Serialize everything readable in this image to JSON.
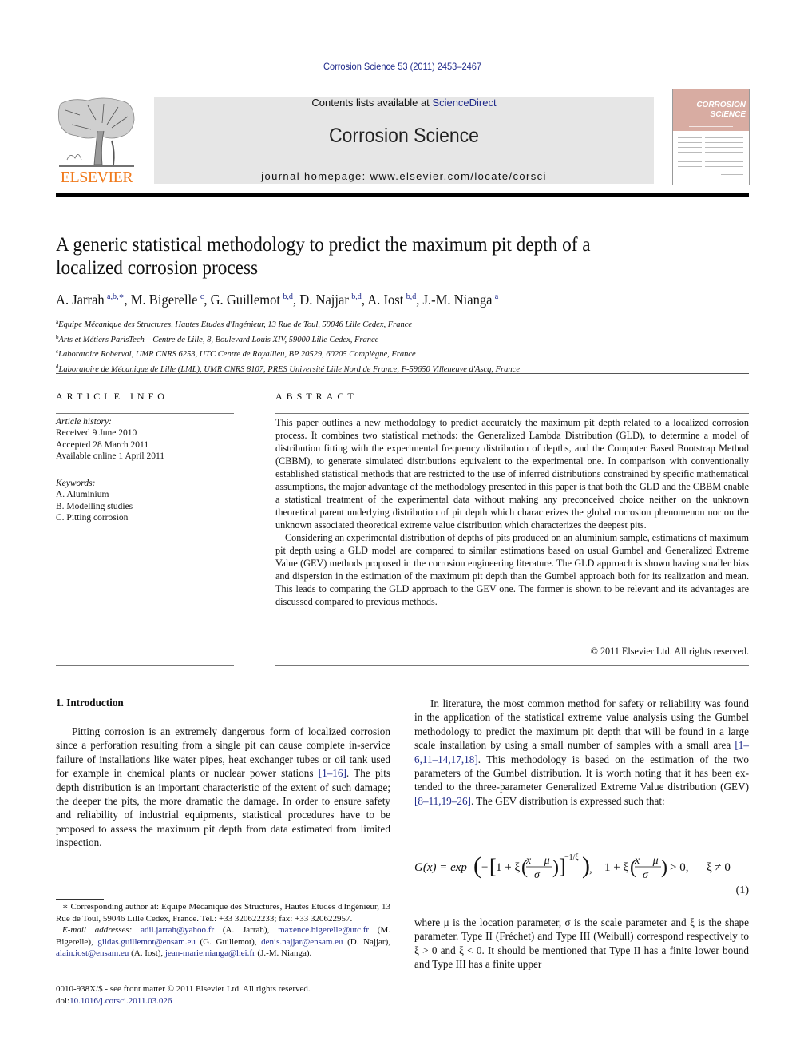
{
  "header": {
    "citation": "Corrosion Science 53 (2011) 2453–2467",
    "contents_prefix": "Contents lists available at ",
    "contents_link": "ScienceDirect",
    "journal_title": "Corrosion Science",
    "homepage": "journal homepage: www.elsevier.com/locate/corsci",
    "publisher_logo_text": "ELSEVIER",
    "cover": {
      "line1": "CORROSION",
      "line2": "SCIENCE",
      "color": "#d8aca2"
    },
    "colors": {
      "link": "#1f2a8a",
      "elsevier_orange": "#f07a1c",
      "banner_bg": "#e6e6e6"
    }
  },
  "article": {
    "title": "A generic statistical methodology to predict the maximum pit depth of a localized corrosion process",
    "authors": [
      {
        "name": "A. Jarrah",
        "aff": "a,b,∗"
      },
      {
        "name": "M. Bigerelle",
        "aff": "c"
      },
      {
        "name": "G. Guillemot",
        "aff": "b,d"
      },
      {
        "name": "D. Najjar",
        "aff": "b,d"
      },
      {
        "name": "A. Iost",
        "aff": "b,d"
      },
      {
        "name": "J.-M. Nianga",
        "aff": "a"
      }
    ],
    "affiliations": [
      {
        "key": "a",
        "text": "Equipe Mécanique des Structures, Hautes Etudes d'Ingénieur, 13 Rue de Toul, 59046 Lille Cedex, France"
      },
      {
        "key": "b",
        "text": "Arts et Métiers ParisTech – Centre de Lille, 8, Boulevard Louis XIV, 59000 Lille Cedex, France"
      },
      {
        "key": "c",
        "text": "Laboratoire Roberval, UMR CNRS 6253, UTC Centre de Royallieu, BP 20529, 60205 Compiègne, France"
      },
      {
        "key": "d",
        "text": "Laboratoire de Mécanique de Lille (LML), UMR CNRS 8107, PRES Université Lille Nord de France, F-59650 Villeneuve d'Ascq, France"
      }
    ]
  },
  "article_info": {
    "heading": "ARTICLE INFO",
    "history_label": "Article history:",
    "history": [
      "Received 9 June 2010",
      "Accepted 28 March 2011",
      "Available online 1 April 2011"
    ],
    "keywords_label": "Keywords:",
    "keywords": [
      "A. Aluminium",
      "B. Modelling studies",
      "C. Pitting corrosion"
    ]
  },
  "abstract": {
    "heading": "ABSTRACT",
    "paragraphs": [
      "This paper outlines a new methodology to predict accurately the maximum pit depth related to a local­ized corrosion process. It combines two statistical methods: the Generalized Lambda Distribution (GLD), to determine a model of distribution fitting with the experimental frequency distribution of depths, and the Computer Based Bootstrap Method (CBBM), to generate simulated distributions equivalent to the experimental one. In comparison with conventionally established statistical methods that are restricted to the use of inferred distributions constrained by specific mathematical assumptions, the major advan­tage of the methodology presented in this paper is that both the GLD and the CBBM enable a statistical treatment of the experimental data without making any preconceived choice neither on the unknown theoretical parent underlying distribution of pit depth which characterizes the global corrosion phenom­enon nor on the unknown associated theoretical extreme value distribution which characterizes the deepest pits.",
      "Considering an experimental distribution of depths of pits produced on an aluminium sample, estima­tions of maximum pit depth using a GLD model are compared to similar estimations based on usual Gum­bel and Generalized Extreme Value (GEV) methods proposed in the corrosion engineering literature. The GLD approach is shown having smaller bias and dispersion in the estimation of the maximum pit depth than the Gumbel approach both for its realization and mean. This leads to comparing the GLD approach to the GEV one. The former is shown to be relevant and its advantages are discussed compared to previous methods."
    ],
    "copyright": "© 2011 Elsevier Ltd. All rights reserved."
  },
  "body": {
    "intro_heading": "1. Introduction",
    "left_p1_a": "Pitting corrosion is an extremely dangerous form of localized corrosion since a perforation resulting from a single pit can cause complete in-service failure of installations like water pipes, heat exchanger tubes or oil tank used for example in chemical plants or nuclear power stations ",
    "left_p1_ref": "[1–16]",
    "left_p1_b": ". The pits depth distribution is an important characteristic of the extent of such damage; the dee­per the pits, the more dramatic the damage. In order to ensure safety and reliability of industrial equipments, statistical proce­dures have to be proposed to assess the maximum pit depth from data estimated from limited inspection.",
    "right_p1_a": "In literature, the most common method for safety or reliability was found in the application of the statistical extreme value anal­ysis using the Gumbel methodology to predict the maximum pit depth that will be found in a large scale installation by using a small number of samples with a small area ",
    "right_p1_ref1": "[1–6,11–14,17,18]",
    "right_p1_b": ". This methodology is based on the estimation of the two parameters of the Gumbel distribution. It is worth noting that it has been ex­tended to the three-parameter Generalized Extreme Value distri­bution (GEV) ",
    "right_p1_ref2": "[8–11,19–26]",
    "right_p1_c": ". The GEV distribution is expressed such that:",
    "equation": {
      "lhs": "G(x) = exp",
      "condition": "> 0,",
      "xi_cond": "ξ ≠ 0",
      "exponent": "−1/ξ",
      "numerator": "x − μ",
      "denominator": "σ",
      "number": "(1)"
    },
    "right_p2": "where μ is the location parameter, σ is the scale parameter and ξ is the shape parameter. Type II (Fréchet) and Type III (Weibull) corre­spond respectively to ξ > 0 and ξ < 0. It should be mentioned that Type II has a finite lower bound and Type III has a finite upper"
  },
  "footnotes": {
    "corresponding": "∗ Corresponding author at: Equipe Mécanique des Structures, Hautes Etudes d'Ingénieur, 13 Rue de Toul, 59046 Lille Cedex, France. Tel.: +33 320622233; fax: +33 320622957.",
    "email_label": "E-mail addresses:",
    "emails": [
      {
        "addr": "adil.jarrah@yahoo.fr",
        "who": "(A. Jarrah), "
      },
      {
        "addr": "maxence.bigerelle@utc.fr",
        "who": "(M. Bigerelle), "
      },
      {
        "addr": "gildas.guillemot@ensam.eu",
        "who": "(G. Guillemot), "
      },
      {
        "addr": "denis.najjar@ensam.eu",
        "who": "(D. Najjar), "
      },
      {
        "addr": "alain.iost@ensam.eu",
        "who": "(A. Iost), "
      },
      {
        "addr": "jean-marie.nianga@hei.fr",
        "who": "(J.-M. Nianga)."
      }
    ],
    "front_matter": "0010-938X/$ - see front matter © 2011 Elsevier Ltd. All rights reserved.",
    "doi_label": "doi:",
    "doi": "10.1016/j.corsci.2011.03.026"
  }
}
